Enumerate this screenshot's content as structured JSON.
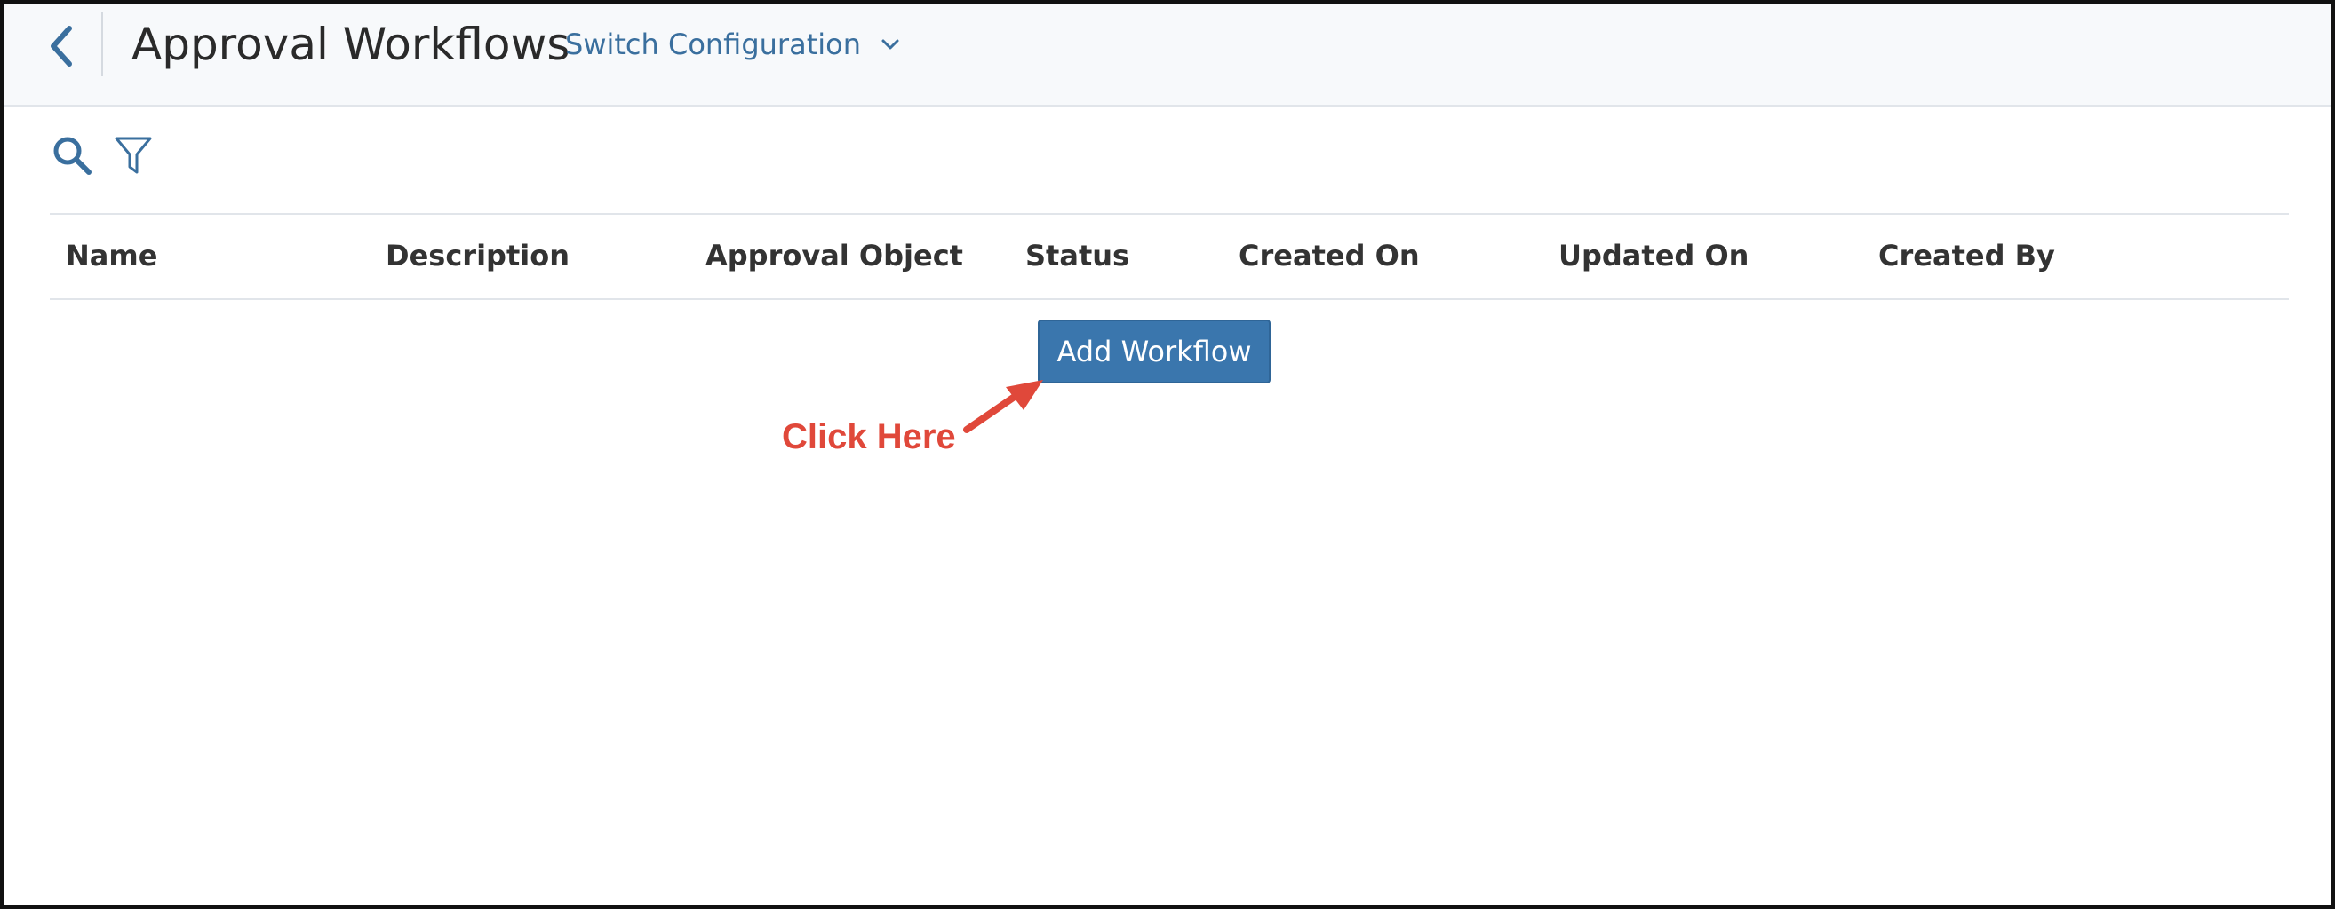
{
  "header": {
    "back_icon": "chevron-left-icon",
    "title": "Approval Workflows",
    "switch_config_label": "Switch Configuration",
    "switch_config_icon": "chevron-down-icon"
  },
  "toolbar": {
    "search_icon": "search-icon",
    "filter_icon": "filter-icon"
  },
  "table": {
    "columns": [
      "Name",
      "Description",
      "Approval Object",
      "Status",
      "Created On",
      "Updated On",
      "Created By"
    ],
    "rows": []
  },
  "empty_state": {
    "add_button_label": "Add Workflow"
  },
  "annotation": {
    "text": "Click Here",
    "color": "#e0483a"
  },
  "colors": {
    "accent": "#3a76ad",
    "link": "#3a6f9e",
    "header_bg": "#f7f9fb"
  }
}
